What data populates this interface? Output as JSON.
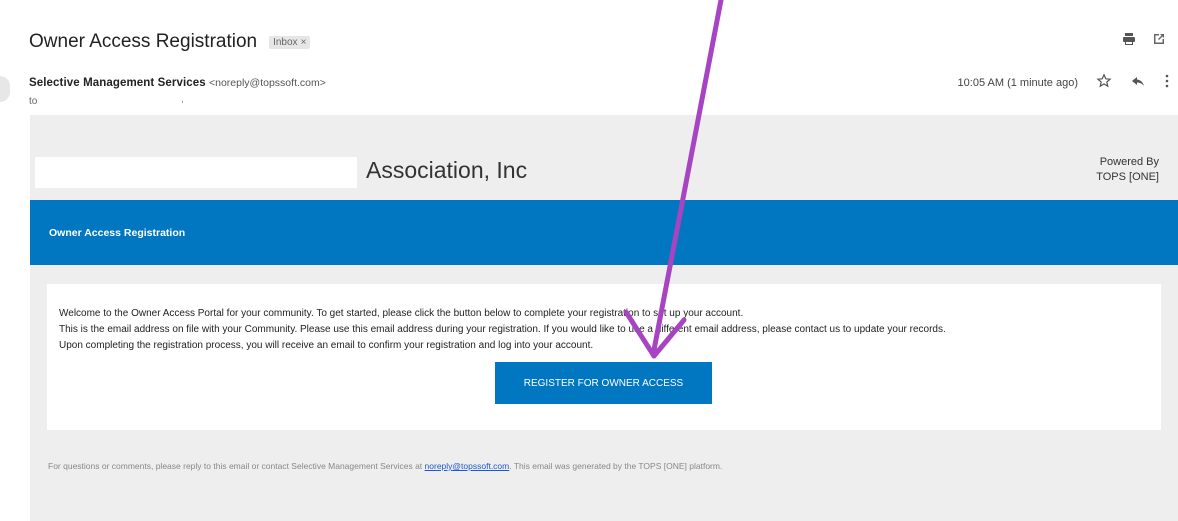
{
  "email": {
    "subject": "Owner Access Registration",
    "label_badge": "Inbox",
    "sender_name": "Selective Management Services",
    "sender_email": "<noreply@topssoft.com>",
    "to_label": "to",
    "timestamp": "10:05 AM (1 minute ago)"
  },
  "icons": {
    "print": "print-icon",
    "popout": "open-in-new-window-icon",
    "star": "star-icon",
    "reply": "reply-icon",
    "more": "more-vert-icon"
  },
  "body": {
    "association_name": "Association, Inc",
    "powered_by_line1": "Powered By",
    "powered_by_line2": "TOPS [ONE]",
    "banner_title": "Owner Access Registration",
    "paragraphs": [
      "Welcome to the Owner Access Portal for your community. To get started, please click the button below to complete your registration to set up your account.",
      "This is the email address on file with your Community. Please use this email address during your registration. If you would like to use a different email address, please contact us to update your records.",
      "Upon completing the registration process, you will receive an email to confirm your registration and log into your account."
    ],
    "button_label": "REGISTER FOR OWNER ACCESS",
    "footer_pre": "For questions or comments, please reply to this email or contact Selective Management Services at ",
    "footer_link": "noreply@topssoft.com",
    "footer_post": ". This email was generated by the TOPS [ONE] platform."
  },
  "colors": {
    "brand_blue": "#0077c0",
    "body_bg": "#eeeeee",
    "annotation_arrow": "#a744c2"
  }
}
